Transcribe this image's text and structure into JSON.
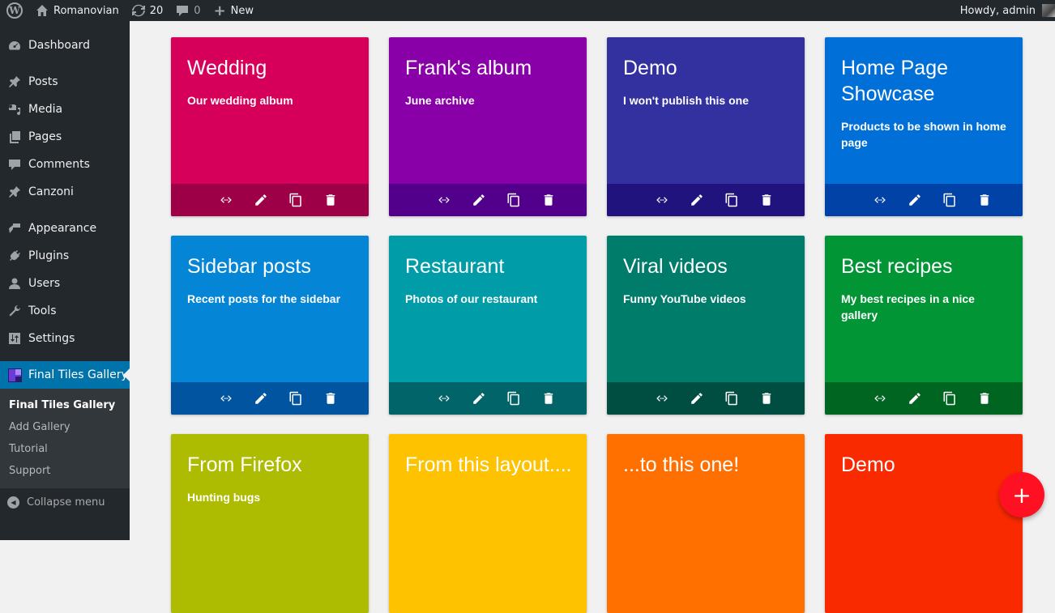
{
  "adminbar": {
    "site_name": "Romanovian",
    "updates_count": "20",
    "comments_count": "0",
    "new_label": "New",
    "greeting": "Howdy, admin"
  },
  "sidebar": {
    "items": [
      {
        "label": "Dashboard",
        "icon": "dashboard-icon"
      },
      {
        "label": "Posts",
        "icon": "pin-icon"
      },
      {
        "label": "Media",
        "icon": "media-icon"
      },
      {
        "label": "Pages",
        "icon": "pages-icon"
      },
      {
        "label": "Comments",
        "icon": "comment-icon"
      },
      {
        "label": "Canzoni",
        "icon": "pin-icon"
      },
      {
        "label": "Appearance",
        "icon": "brush-icon"
      },
      {
        "label": "Plugins",
        "icon": "plug-icon"
      },
      {
        "label": "Users",
        "icon": "user-icon"
      },
      {
        "label": "Tools",
        "icon": "wrench-icon"
      },
      {
        "label": "Settings",
        "icon": "settings-icon"
      },
      {
        "label": "Final Tiles Gallery",
        "icon": "final-tiles-icon"
      }
    ],
    "submenu": [
      "Final Tiles Gallery",
      "Add Gallery",
      "Tutorial",
      "Support"
    ],
    "collapse_label": "Collapse menu"
  },
  "galleries": [
    {
      "title": "Wedding",
      "description": "Our wedding album",
      "color": "#d6005a",
      "bar_color": "#9e0048"
    },
    {
      "title": "Frank's album",
      "description": "June archive",
      "color": "#8a00a8",
      "bar_color": "#52008c"
    },
    {
      "title": "Demo",
      "description": "I won't publish this one",
      "color": "#3330a0",
      "bar_color": "#20137e"
    },
    {
      "title": "Home Page Showcase",
      "description": "Products to be shown in home page",
      "color": "#0070d8",
      "bar_color": "#0042a6"
    },
    {
      "title": "Sidebar posts",
      "description": "Recent posts for the sidebar",
      "color": "#0585d6",
      "bar_color": "#0054a0"
    },
    {
      "title": "Restaurant",
      "description": "Photos of our restaurant",
      "color": "#009da8",
      "bar_color": "#006468"
    },
    {
      "title": "Viral videos",
      "description": "Funny YouTube videos",
      "color": "#007c6a",
      "bar_color": "#004e42"
    },
    {
      "title": "Best recipes",
      "description": "My best recipes in a nice gallery",
      "color": "#019536",
      "bar_color": "#006520"
    },
    {
      "title": "From Firefox",
      "description": "Hunting bugs",
      "color": "#adbc00",
      "bar_color": ""
    },
    {
      "title": "From this layout....",
      "description": "",
      "color": "#ffc200",
      "bar_color": ""
    },
    {
      "title": "...to this one!",
      "description": "",
      "color": "#ff7000",
      "bar_color": ""
    },
    {
      "title": "Demo",
      "description": "",
      "color": "#fa2a00",
      "bar_color": ""
    }
  ],
  "tile_actions": [
    {
      "name": "shortcode-button",
      "icon": "code-icon"
    },
    {
      "name": "edit-button",
      "icon": "pencil-icon"
    },
    {
      "name": "clone-button",
      "icon": "copy-icon"
    },
    {
      "name": "delete-button",
      "icon": "trash-icon"
    }
  ],
  "fab": {
    "label": "+",
    "color": "#ff1022"
  }
}
